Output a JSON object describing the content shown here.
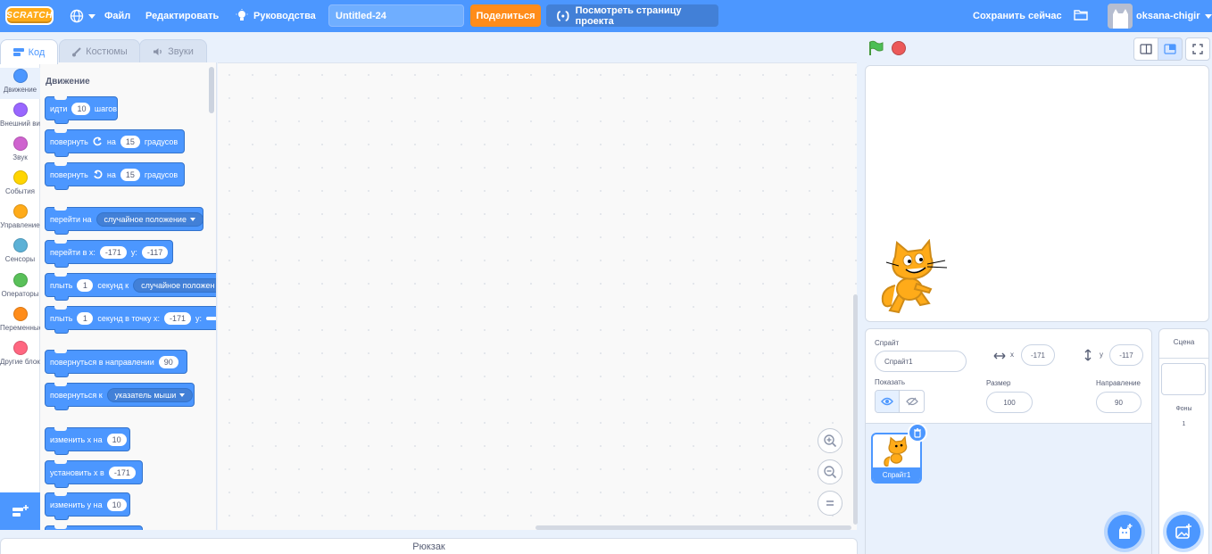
{
  "menubar": {
    "logo": "SCRATCH",
    "file": "Файл",
    "edit": "Редактировать",
    "tutorials": "Руководства",
    "project_title": "Untitled-24",
    "share": "Поделиться",
    "see_project_page": "Посмотреть страницу проекта",
    "save_now": "Сохранить сейчас",
    "username": "oksana-chigir"
  },
  "tabs": {
    "code": "Код",
    "costumes": "Костюмы",
    "sounds": "Звуки"
  },
  "categories": [
    {
      "label": "Движение",
      "color": "#4c97ff"
    },
    {
      "label": "Внешний вид",
      "color": "#9966ff"
    },
    {
      "label": "Звук",
      "color": "#cf63cf"
    },
    {
      "label": "События",
      "color": "#ffd500"
    },
    {
      "label": "Управление",
      "color": "#ffab19"
    },
    {
      "label": "Сенсоры",
      "color": "#5cb1d6"
    },
    {
      "label": "Операторы",
      "color": "#59c059"
    },
    {
      "label": "Переменные",
      "color": "#ff8c1a"
    },
    {
      "label": "Другие блоки",
      "color": "#ff6680"
    }
  ],
  "palette": {
    "heading": "Движение",
    "blocks": {
      "move": {
        "t1": "идти",
        "v1": "10",
        "t2": "шагов"
      },
      "turn_right": {
        "t1": "повернуть",
        "t2": "на",
        "v1": "15",
        "t3": "градусов"
      },
      "turn_left": {
        "t1": "повернуть",
        "t2": "на",
        "v1": "15",
        "t3": "градусов"
      },
      "goto": {
        "t1": "перейти на",
        "menu": "случайное положение"
      },
      "goto_xy": {
        "t1": "перейти в x:",
        "v1": "-171",
        "t2": "y:",
        "v2": "-117"
      },
      "glide": {
        "t1": "плыть",
        "v1": "1",
        "t2": "секунд к",
        "menu": "случайное положен"
      },
      "glide_xy": {
        "t1": "плыть",
        "v1": "1",
        "t2": "секунд в точку x:",
        "v2": "-171",
        "t3": "y:"
      },
      "point_dir": {
        "t1": "повернуться в направлении",
        "v1": "90"
      },
      "point_towards": {
        "t1": "повернуться к",
        "menu": "указатель мыши"
      },
      "change_x": {
        "t1": "изменить х на",
        "v1": "10"
      },
      "set_x": {
        "t1": "установить х в",
        "v1": "-171"
      },
      "change_y": {
        "t1": "изменить у на",
        "v1": "10"
      }
    }
  },
  "backpack": "Рюкзак",
  "sprite_info": {
    "sprite_label": "Спрайт",
    "sprite_name": "Спрайт1",
    "x_label": "x",
    "x_value": "-171",
    "y_label": "y",
    "y_value": "-117",
    "show_label": "Показать",
    "size_label": "Размер",
    "size_value": "100",
    "direction_label": "Направление",
    "direction_value": "90"
  },
  "sprite_list": [
    {
      "name": "Спрайт1"
    }
  ],
  "stage_pane": {
    "title": "Сцена",
    "backdrops_label": "Фоны",
    "backdrops_count": "1"
  },
  "colors": {
    "menubar": "#4c97ff",
    "share": "#ff8c1a",
    "motion": "#4c97ff"
  }
}
